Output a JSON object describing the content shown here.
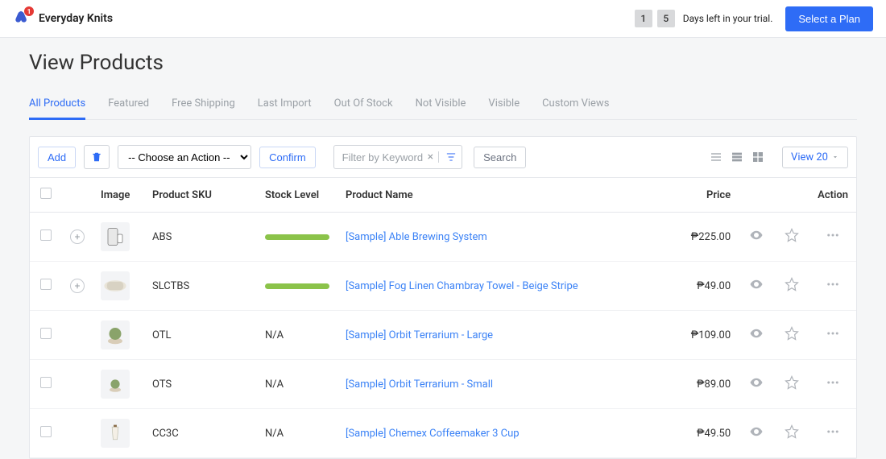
{
  "header": {
    "brand": "Everyday Knits",
    "badge": "1",
    "trial_digits": [
      "1",
      "5"
    ],
    "trial_text": "Days left in your trial.",
    "plan_button": "Select a Plan"
  },
  "page": {
    "title": "View Products"
  },
  "tabs": [
    {
      "label": "All Products",
      "active": true
    },
    {
      "label": "Featured",
      "active": false
    },
    {
      "label": "Free Shipping",
      "active": false
    },
    {
      "label": "Last Import",
      "active": false
    },
    {
      "label": "Out Of Stock",
      "active": false
    },
    {
      "label": "Not Visible",
      "active": false
    },
    {
      "label": "Visible",
      "active": false
    },
    {
      "label": "Custom Views",
      "active": false
    }
  ],
  "toolbar": {
    "add": "Add",
    "action_placeholder": "-- Choose an Action --",
    "confirm": "Confirm",
    "filter_placeholder": "Filter by Keyword",
    "search": "Search",
    "view_label": "View 20"
  },
  "columns": {
    "image": "Image",
    "sku": "Product SKU",
    "stock": "Stock Level",
    "name": "Product Name",
    "price": "Price",
    "action": "Action"
  },
  "rows": [
    {
      "expand": true,
      "sku": "ABS",
      "stock": "bar",
      "name": "[Sample] Able Brewing System",
      "price": "₱225.00"
    },
    {
      "expand": true,
      "sku": "SLCTBS",
      "stock": "bar",
      "name": "[Sample] Fog Linen Chambray Towel - Beige Stripe",
      "price": "₱49.00"
    },
    {
      "expand": false,
      "sku": "OTL",
      "stock": "N/A",
      "name": "[Sample] Orbit Terrarium - Large",
      "price": "₱109.00"
    },
    {
      "expand": false,
      "sku": "OTS",
      "stock": "N/A",
      "name": "[Sample] Orbit Terrarium - Small",
      "price": "₱89.00"
    },
    {
      "expand": false,
      "sku": "CC3C",
      "stock": "N/A",
      "name": "[Sample] Chemex Coffeemaker 3 Cup",
      "price": "₱49.50"
    }
  ]
}
